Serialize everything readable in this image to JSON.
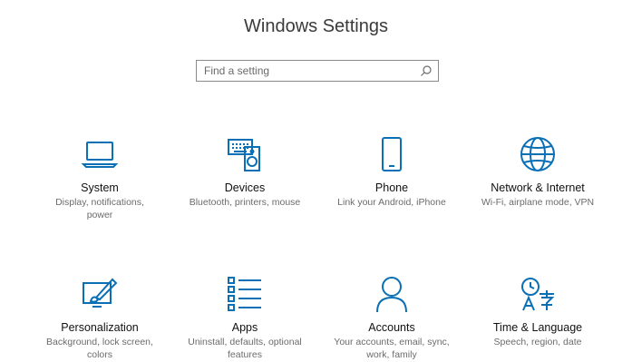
{
  "window": {
    "title": "Windows Settings"
  },
  "search": {
    "placeholder": "Find a setting",
    "icon": "search-icon"
  },
  "tiles": [
    {
      "name": "System",
      "desc": "Display, notifications,\npower",
      "icon": "laptop-icon"
    },
    {
      "name": "Devices",
      "desc": "Bluetooth, printers, mouse",
      "icon": "keyboard-speaker-icon"
    },
    {
      "name": "Phone",
      "desc": "Link your Android, iPhone",
      "icon": "phone-icon"
    },
    {
      "name": "Network & Internet",
      "desc": "Wi-Fi, airplane mode, VPN",
      "icon": "globe-icon"
    },
    {
      "name": "Personalization",
      "desc": "Background, lock screen,\ncolors",
      "icon": "paint-brush-icon"
    },
    {
      "name": "Apps",
      "desc": "Uninstall, defaults, optional\nfeatures",
      "icon": "apps-list-icon"
    },
    {
      "name": "Accounts",
      "desc": "Your accounts, email, sync,\nwork, family",
      "icon": "person-icon"
    },
    {
      "name": "Time & Language",
      "desc": "Speech, region, date",
      "icon": "time-language-icon"
    }
  ],
  "colors": {
    "accent": "#0a6fb5",
    "text": "#111111",
    "subtext": "#6b6b6b"
  }
}
